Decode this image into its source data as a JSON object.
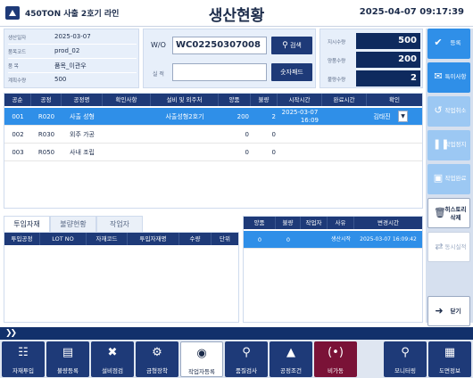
{
  "header": {
    "line_name": "450TON 사출 2호기 라인",
    "title": "생산현황",
    "datetime": "2025-04-07 09:17:39"
  },
  "info": {
    "rows": [
      {
        "label": "생산일자",
        "value": "2025-03-07"
      },
      {
        "label": "품목코드",
        "value": "prod_02"
      },
      {
        "label": "품    목",
        "value": "품목_이관우"
      },
      {
        "label": "계획수량",
        "value": "500"
      }
    ]
  },
  "wo": {
    "wo_label": "W/O",
    "wo_value": "WC02250307008",
    "search_label": "검색",
    "act_label": "실  적",
    "act_value": "",
    "keypad_label": "숫자패드"
  },
  "qty": {
    "rows": [
      {
        "label": "지시수량",
        "value": "500"
      },
      {
        "label": "양품수량",
        "value": "200"
      },
      {
        "label": "불량수량",
        "value": "2"
      }
    ]
  },
  "side_buttons": {
    "register": "등록",
    "special": "특이사항",
    "cancel_work": "작업취소",
    "stop_work": "작업정지",
    "complete_work": "작업완료",
    "history_delete": "히스토리 삭제",
    "sync_result": "동시실적",
    "close": "닫기"
  },
  "proc_table": {
    "headers": [
      "공순",
      "공정",
      "공정명",
      "확인사항",
      "설비 및 외주처",
      "양품",
      "불량",
      "시작시간",
      "완료시간",
      "확인"
    ],
    "rows": [
      {
        "seq": "001",
        "code": "R020",
        "name": "사출 성형",
        "check": "",
        "equip": "사출성형2호기",
        "good": "200",
        "bad": "2",
        "start_date": "2025-03-07",
        "start_time": "16:09",
        "end": "",
        "confirm": "김태진",
        "selected": true
      },
      {
        "seq": "002",
        "code": "R030",
        "name": "외주 가공",
        "check": "",
        "equip": "",
        "good": "0",
        "bad": "0",
        "start_date": "",
        "start_time": "",
        "end": "",
        "confirm": "",
        "selected": false
      },
      {
        "seq": "003",
        "code": "R050",
        "name": "사내 조립",
        "check": "",
        "equip": "",
        "good": "0",
        "bad": "0",
        "start_date": "",
        "start_time": "",
        "end": "",
        "confirm": "",
        "selected": false
      }
    ]
  },
  "tabs": {
    "items": [
      "투입자재",
      "불량현황",
      "작업자"
    ]
  },
  "mat_table": {
    "headers": [
      "투입공정",
      "LOT NO",
      "자재코드",
      "투입자재명",
      "수량",
      "단위"
    ]
  },
  "hist_table": {
    "headers": [
      "양품",
      "불량",
      "작업자",
      "사유",
      "변경시간"
    ],
    "row": {
      "good": "0",
      "bad": "0",
      "worker": "",
      "reason": "생산시작",
      "time": "2025-03-07 16:09:42"
    }
  },
  "bottom_buttons": {
    "material_input": "자재투입",
    "defect_register": "불량등록",
    "equip_check": "설비점검",
    "mold_mount": "금형장착",
    "worker_register": "작업자등록",
    "quality_check": "품질검사",
    "process_cond": "공정조건",
    "downtime": "비가동",
    "monitoring": "모니터링",
    "drawing_info": "도면정보"
  },
  "colors": {
    "navy": "#1e3a78",
    "dark_navy": "#0e2a5e",
    "blue": "#2f8fe8",
    "light_blue": "#9cc8f3",
    "maroon": "#7a1237",
    "panel_bg": "#e7effa"
  }
}
